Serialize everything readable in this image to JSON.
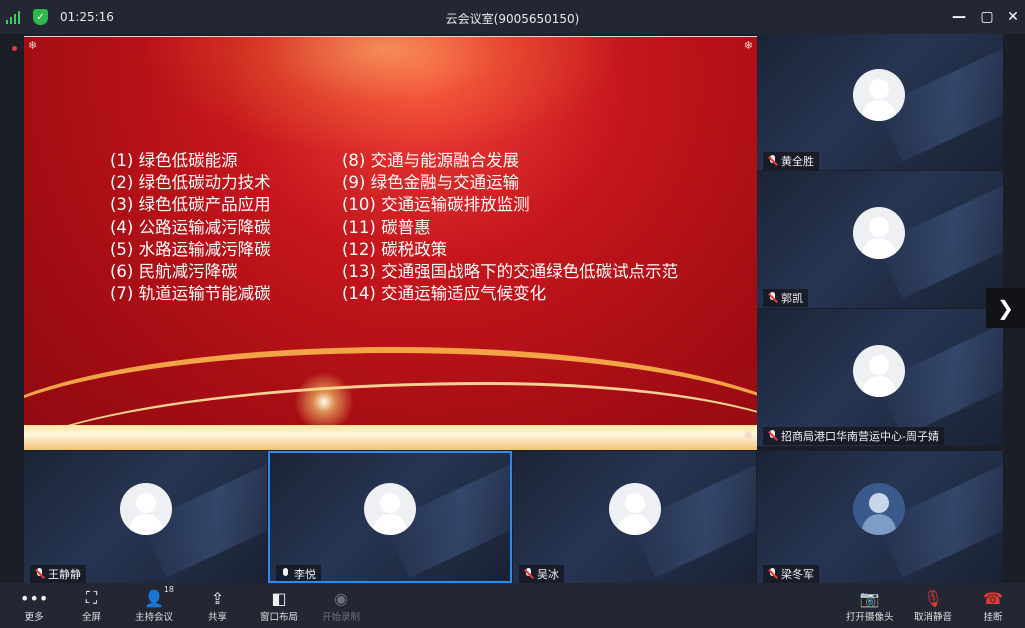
{
  "window": {
    "time": "01:25:16",
    "title": "云会议室(9005650150)"
  },
  "slide": {
    "left_items": [
      "(1) 绿色低碳能源",
      "(2) 绿色低碳动力技术",
      "(3) 绿色低碳产品应用",
      "(4) 公路运输减污降碳",
      "(5) 水路运输减污降碳",
      "(6) 民航减污降碳",
      "(7) 轨道运输节能减碳"
    ],
    "right_items": [
      "(8) 交通与能源融合发展",
      "(9) 绿色金融与交通运输",
      "(10) 交通运输碳排放监测",
      "(11) 碳普惠",
      "(12) 碳税政策",
      "(13) 交通强国战略下的交通绿色低碳试点示范",
      "(14) 交通运输适应气候变化"
    ]
  },
  "participants": {
    "right": [
      "黄全胜",
      "郭凯",
      "招商局港口华南营运中心-周子婧"
    ],
    "bottom": [
      "王静静",
      "李悦",
      "吴冰",
      "梁冬军"
    ]
  },
  "toolbar": {
    "more": "更多",
    "fullscreen": "全屏",
    "host": "主持会议",
    "host_count": "18",
    "share": "共享",
    "layout": "窗口布局",
    "record": "开始录制",
    "camera": "打开摄像头",
    "unmute": "取消静音",
    "hangup": "挂断"
  },
  "colors": {
    "accent": "#2b8cf0",
    "danger": "#e53935",
    "ok": "#2fb84a"
  }
}
